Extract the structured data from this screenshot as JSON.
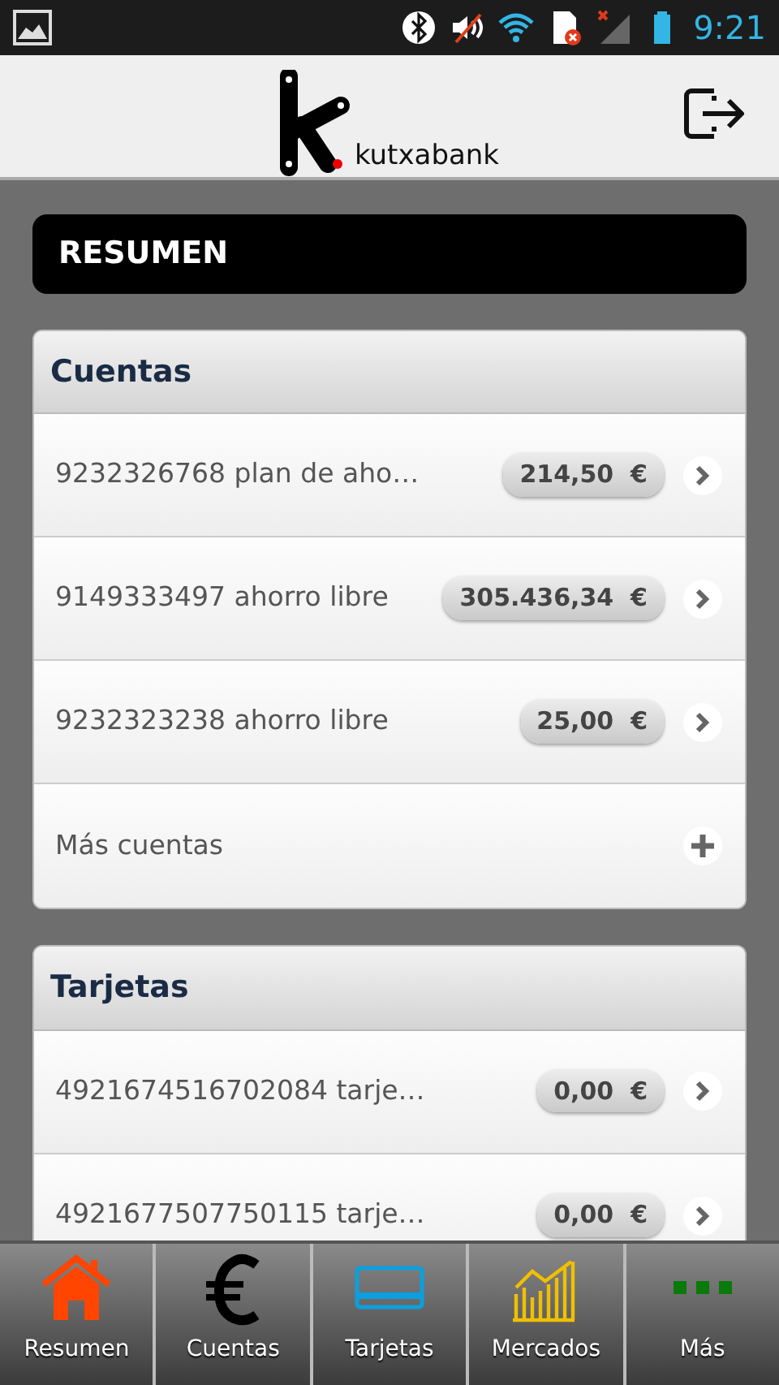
{
  "status_bar": {
    "time": "9:21"
  },
  "header": {
    "brand": "kutxabank"
  },
  "page_title": "RESUMEN",
  "sections": [
    {
      "title": "Cuentas",
      "rows": [
        {
          "kind": "item",
          "label": "9232326768 plan de aho…",
          "amount": "214,50  €"
        },
        {
          "kind": "item",
          "label": "9149333497 ahorro libre",
          "amount": "305.436,34  €"
        },
        {
          "kind": "item",
          "label": "9232323238 ahorro libre",
          "amount": "25,00  €"
        },
        {
          "kind": "more",
          "label": "Más cuentas"
        }
      ]
    },
    {
      "title": "Tarjetas",
      "rows": [
        {
          "kind": "item",
          "label": "4921674516702084 tarje…",
          "amount": "0,00  €"
        },
        {
          "kind": "item",
          "label": "4921677507750115 tarje…",
          "amount": "0,00  €"
        }
      ]
    }
  ],
  "tab_bar": [
    {
      "kind": "home",
      "label": "Resumen"
    },
    {
      "kind": "euro",
      "label": "Cuentas"
    },
    {
      "kind": "card",
      "label": "Tarjetas"
    },
    {
      "kind": "chart",
      "label": "Mercados"
    },
    {
      "kind": "more",
      "label": "Más"
    }
  ]
}
